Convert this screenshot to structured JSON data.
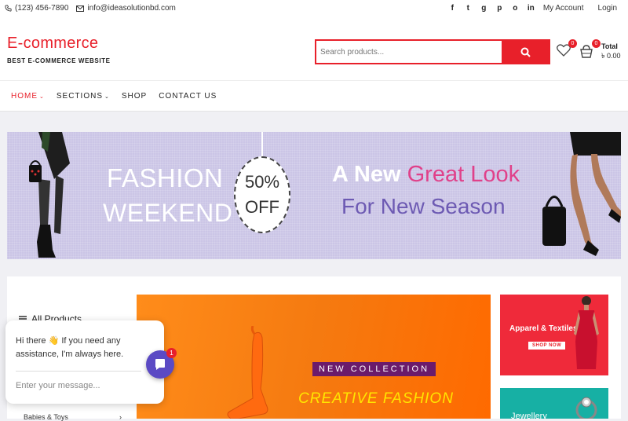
{
  "topbar": {
    "phone": "(123) 456-7890",
    "email": "info@ideasolutionbd.com",
    "social": [
      "f",
      "t",
      "g",
      "p",
      "o",
      "in"
    ],
    "my_account": "My Account",
    "login": "Login"
  },
  "header": {
    "logo_title": "E-commerce",
    "logo_subtitle": "BEST E-COMMERCE WEBSITE",
    "search_placeholder": "Search products...",
    "wishlist_count": "0",
    "cart_count": "0",
    "total_label": "Total",
    "total_value": "৳ 0.00"
  },
  "nav": {
    "items": [
      "HOME",
      "SECTIONS",
      "SHOP",
      "CONTACT US"
    ]
  },
  "banner": {
    "line1": "FASHION",
    "line2": "WEEKEND",
    "discount_top": "50%",
    "discount_bottom": "OFF",
    "tag_white": "A New ",
    "tag_pink": "Great Look",
    "tag_line2": "For New Season"
  },
  "sidebar": {
    "all_products": "All Products",
    "babies": "Babies & Toys"
  },
  "hero": {
    "new_collection": "NEW COLLECTION",
    "creative": "CREATIVE FASHION"
  },
  "promos": {
    "apparel": "Apparel & Textiles",
    "shop_now": "SHOP NOW",
    "jewellery": "Jewellery"
  },
  "chat": {
    "message": "Hi there 👋 If you need any assistance, I'm always here.",
    "input_placeholder": "Enter your message...",
    "badge": "1"
  },
  "colors": {
    "accent": "#e8202a",
    "banner_bg": "#cbc5e6",
    "hero_orange": "#f57a10",
    "chat_purple": "#5b4ac4"
  }
}
